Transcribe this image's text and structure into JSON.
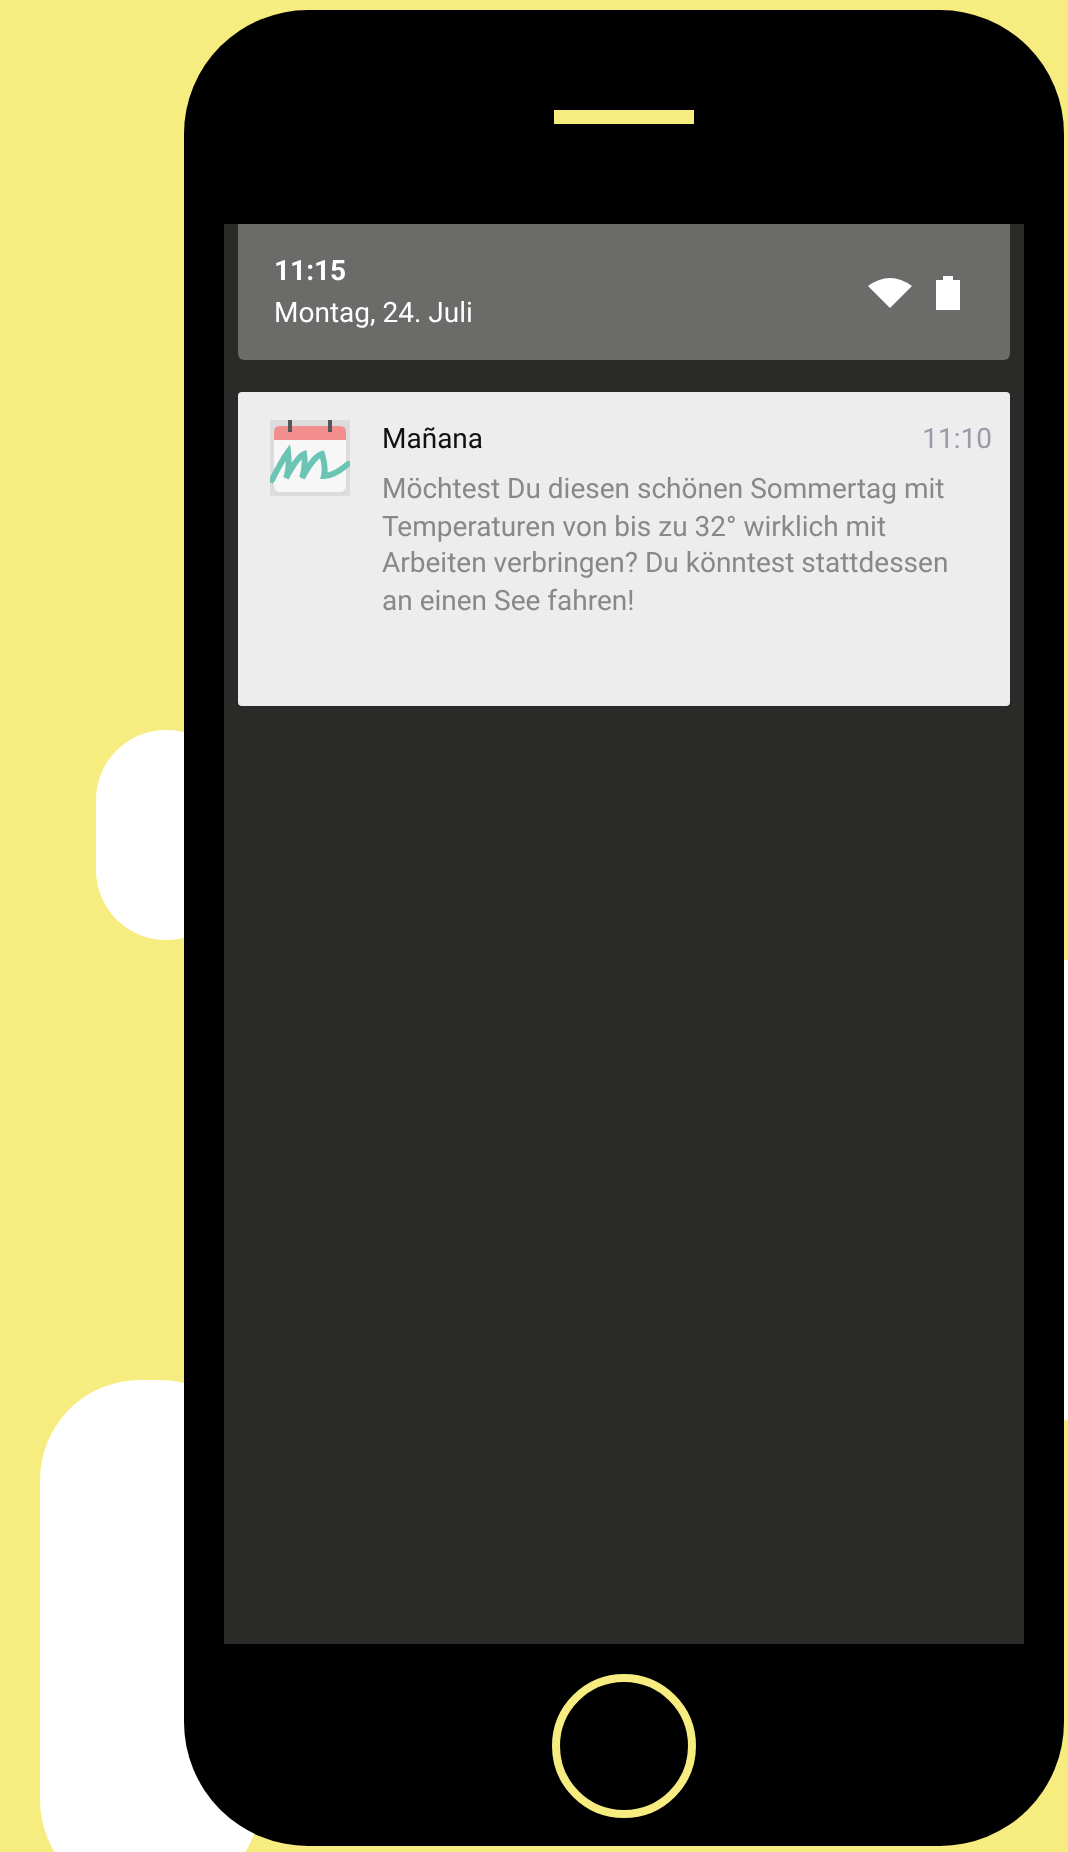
{
  "status_panel": {
    "time": "11:15",
    "date": "Montag, 24. Juli"
  },
  "notifications": [
    {
      "app": "Mañana",
      "time": "11:10",
      "body": "Möchtest Du diesen schönen Sommertag mit Temperaturen von bis zu 32° wirklich mit Arbeiten verbringen? Du könntest stattdessen an einen See fahren!"
    }
  ]
}
